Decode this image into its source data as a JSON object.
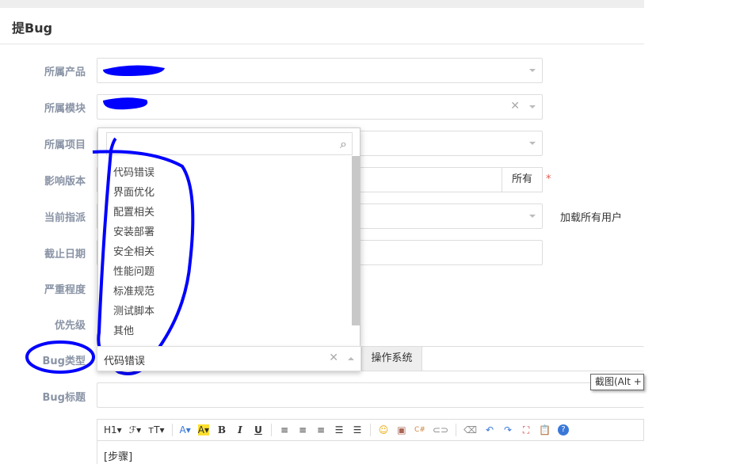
{
  "page": {
    "title": "提Bug"
  },
  "form": {
    "labels": [
      "所属产品",
      "所属模块",
      "所属项目",
      "影响版本",
      "当前指派",
      "截止日期",
      "严重程度",
      "优先级",
      "Bug类型",
      "Bug标题"
    ],
    "version_addon": "所有",
    "required_mark": "*",
    "load_all_users": "加载所有用户",
    "bug_type_value": "代码错误",
    "os_addon": "操作系统",
    "screenshot_tooltip": "截图(Alt + A"
  },
  "dropdown": {
    "items": [
      "代码错误",
      "界面优化",
      "配置相关",
      "安装部署",
      "安全相关",
      "性能问题",
      "标准规范",
      "测试脚本",
      "其他"
    ]
  },
  "editor": {
    "toolbar": [
      "H1▾",
      "ℱ▾",
      "тT▾",
      "A▾",
      "A▾",
      "B",
      "I",
      "U",
      "≡",
      "≡",
      "≡",
      "☰",
      "☰",
      "☺",
      "▣",
      "C#",
      "⊂⊃",
      "⌫",
      "↶",
      "↷",
      "⛶",
      "📋",
      "?"
    ],
    "content": "[步骤]"
  },
  "colors": {
    "annotation": "#0000ff",
    "label": "#8a94a6",
    "required": "#e5584f"
  }
}
